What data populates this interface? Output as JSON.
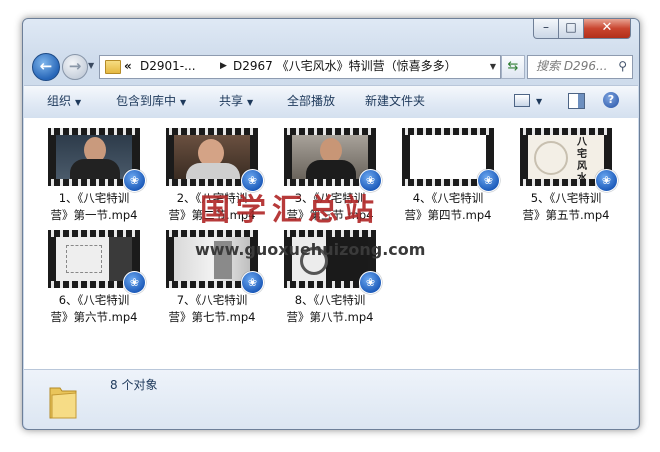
{
  "window": {
    "controls": {
      "minimize": "–",
      "maximize": "□",
      "close": "✕"
    }
  },
  "address": {
    "overflow": "«",
    "segments": [
      "D2901-...",
      "D2967 《八宅风水》特训营（惊喜多多）"
    ],
    "search_placeholder": "搜索 D296..."
  },
  "toolbar": {
    "organize": "组织",
    "include_in_library": "包含到库中",
    "share": "共享",
    "play_all": "全部播放",
    "new_folder": "新建文件夹"
  },
  "files": [
    {
      "line1": "1、《八宅特训",
      "line2": "营》第一节.mp4"
    },
    {
      "line1": "2、《八宅特训",
      "line2": "营》第二节.mp4"
    },
    {
      "line1": "3、《八宅特训",
      "line2": "营》第三节.mp4"
    },
    {
      "line1": "4、《八宅特训",
      "line2": "营》第四节.mp4"
    },
    {
      "line1": "5、《八宅特训",
      "line2": "营》第五节.mp4"
    },
    {
      "line1": "6、《八宅特训",
      "line2": "营》第六节.mp4"
    },
    {
      "line1": "7、《八宅特训",
      "line2": "营》第七节.mp4"
    },
    {
      "line1": "8、《八宅特训",
      "line2": "营》第八节.mp4"
    }
  ],
  "thumb5_text": "八宅风水",
  "watermark": {
    "title": "国学汇总站",
    "url": "www.guoxuehuizong.com"
  },
  "status": {
    "count": "8 个对象"
  },
  "colors": {
    "badge": "#1a58b8",
    "watermark": "#b12a2a",
    "close": "#c9452f"
  }
}
